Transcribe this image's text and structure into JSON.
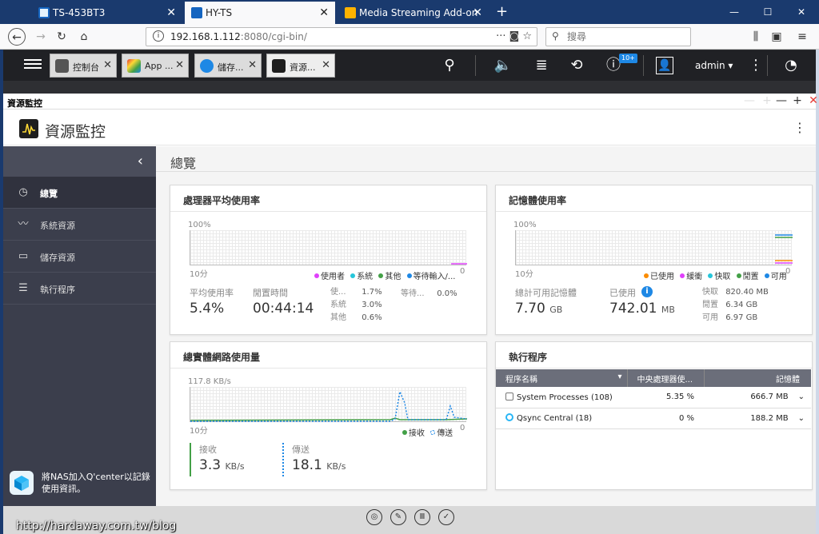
{
  "browser": {
    "tabs": [
      {
        "label": "TS-453BT3",
        "color": "#1565c0"
      },
      {
        "label": "HY-TS",
        "color": "#1565c0"
      },
      {
        "label": "Media Streaming Add-on",
        "color": "#e65100"
      }
    ],
    "url_host": "192.168.1.112",
    "url_rest": ":8080/cgi-bin/",
    "search_placeholder": "搜尋"
  },
  "qts": {
    "app_tabs": [
      {
        "label": "控制台",
        "icon": "gear-icon"
      },
      {
        "label": "App ...",
        "icon": "app-center-icon"
      },
      {
        "label": "儲存...",
        "icon": "storage-icon"
      },
      {
        "label": "資源...",
        "icon": "resource-monitor-icon"
      }
    ],
    "notification_count": "10+",
    "user": "admin ▾"
  },
  "window": {
    "title": "資源監控",
    "app_name": "資源監控"
  },
  "sidebar": {
    "items": [
      {
        "label": "總覽",
        "icon": "dashboard-icon"
      },
      {
        "label": "系統資源",
        "icon": "chart-line-icon"
      },
      {
        "label": "儲存資源",
        "icon": "disk-icon"
      },
      {
        "label": "執行程序",
        "icon": "process-list-icon"
      }
    ],
    "promo": "將NAS加入Q'center以記錄使用資訊。"
  },
  "page_title": "總覽",
  "cpu": {
    "title": "處理器平均使用率",
    "y_top": "100%",
    "x_left": "10分",
    "x_right": "0",
    "legend": [
      "使用者",
      "系統",
      "其他",
      "等待輸入/..."
    ],
    "legend_colors": [
      "#e040fb",
      "#26c6da",
      "#43a047",
      "#1e88e5"
    ],
    "avg_label": "平均使用率",
    "avg_value": "5.4%",
    "idle_label": "閒置時間",
    "idle_value": "00:44:14",
    "breakdown": [
      {
        "k": "使...",
        "v": "1.7%"
      },
      {
        "k": "系統",
        "v": "3.0%"
      },
      {
        "k": "其他",
        "v": "0.6%"
      }
    ],
    "wait_label": "等待...",
    "wait_value": "0.0%"
  },
  "memory": {
    "title": "記憶體使用率",
    "y_top": "100%",
    "x_left": "10分",
    "x_right": "0",
    "legend": [
      "已使用",
      "緩衝",
      "快取",
      "閒置",
      "可用"
    ],
    "legend_colors": [
      "#fb8c00",
      "#e040fb",
      "#26c6da",
      "#43a047",
      "#1e88e5"
    ],
    "total_label": "總計可用記憶體",
    "total_value": "7.70",
    "total_unit": "GB",
    "used_label": "已使用",
    "used_value": "742.01",
    "used_unit": "MB",
    "details": [
      {
        "k": "快取",
        "v": "820.40 MB"
      },
      {
        "k": "閒置",
        "v": "6.34 GB"
      },
      {
        "k": "可用",
        "v": "6.97 GB"
      }
    ]
  },
  "network": {
    "title": "總實體網路使用量",
    "y_top": "117.8 KB/s",
    "x_left": "10分",
    "x_right": "0",
    "legend": [
      "接收",
      "傳送"
    ],
    "legend_colors": [
      "#43a047",
      "#1e88e5"
    ],
    "rx_label": "接收",
    "rx_value": "3.3",
    "rx_unit": "KB/s",
    "tx_label": "傳送",
    "tx_value": "18.1",
    "tx_unit": "KB/s"
  },
  "processes": {
    "title": "執行程序",
    "columns": [
      "程序名稱",
      "中央處理器使...",
      "記憶體"
    ],
    "rows": [
      {
        "name": "System Processes (108)",
        "cpu": "5.35 %",
        "mem": "666.7 MB"
      },
      {
        "name": "Qsync Central (18)",
        "cpu": "0 %",
        "mem": "188.2 MB"
      }
    ]
  },
  "watermark": "http://hardaway.com.tw/blog"
}
